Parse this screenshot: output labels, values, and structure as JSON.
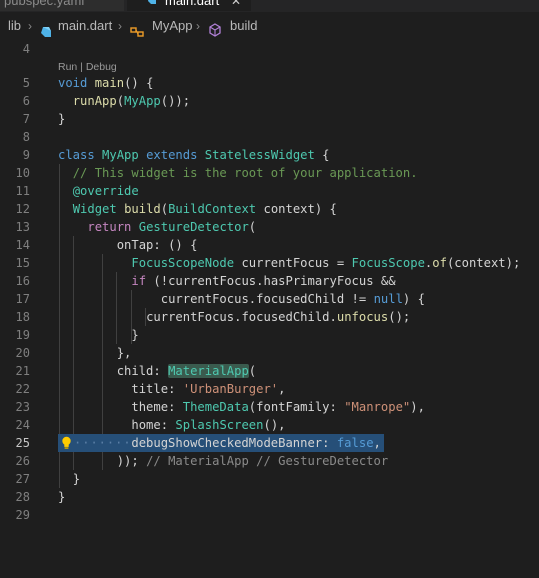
{
  "tabs": [
    {
      "label": "pubspec.yaml",
      "active": false
    },
    {
      "label": "main.dart",
      "active": true,
      "close_glyph": "✕"
    }
  ],
  "breadcrumb": {
    "items": [
      "lib",
      "main.dart",
      "MyApp",
      "build"
    ],
    "separator": "›",
    "icons": [
      "dart-file-icon",
      "class-icon",
      "method-cube-icon"
    ]
  },
  "codelens": "Run | Debug",
  "gutter": [
    "4",
    "5",
    "6",
    "7",
    "8",
    "9",
    "10",
    "11",
    "12",
    "13",
    "14",
    "15",
    "16",
    "17",
    "18",
    "19",
    "20",
    "21",
    "22",
    "23",
    "24",
    "25",
    "26",
    "27",
    "28",
    "29"
  ],
  "active_line_index": 21,
  "code": {
    "l5": {
      "t1": "void",
      "t2": " ",
      "t3": "main",
      "t4": "() {"
    },
    "l6": {
      "t1": "  ",
      "t2": "runApp",
      "t3": "(",
      "t4": "MyApp",
      "t5": "());"
    },
    "l7": {
      "t1": "}"
    },
    "l9": {
      "t1": "class",
      "t2": " ",
      "t3": "MyApp",
      "t4": " ",
      "t5": "extends",
      "t6": " ",
      "t7": "StatelessWidget",
      "t8": " {"
    },
    "l10": {
      "t1": "  ",
      "t2": "// This widget is the root of your application."
    },
    "l11": {
      "t1": "  ",
      "t2": "@override"
    },
    "l12": {
      "t1": "  ",
      "t2": "Widget",
      "t3": " ",
      "t4": "build",
      "t5": "(",
      "t6": "BuildContext",
      "t7": " ",
      "t8": "context",
      "t9": ") {"
    },
    "l13": {
      "t1": "    ",
      "t2": "return",
      "t3": " ",
      "t4": "GestureDetector",
      "t5": "("
    },
    "l14": {
      "t1": "        ",
      "t2": "onTap",
      "t3": ": () {"
    },
    "l15": {
      "t1": "          ",
      "t2": "FocusScopeNode",
      "t3": " ",
      "t4": "currentFocus",
      "t5": " = ",
      "t6": "FocusScope",
      "t7": ".",
      "t8": "of",
      "t9": "(",
      "t10": "context",
      "t11": ");"
    },
    "l16": {
      "t1": "          ",
      "t2": "if",
      "t3": " (!",
      "t4": "currentFocus",
      "t5": ".",
      "t6": "hasPrimaryFocus",
      "t7": " &&"
    },
    "l17": {
      "t1": "              ",
      "t2": "currentFocus",
      "t3": ".",
      "t4": "focusedChild",
      "t5": " != ",
      "t6": "null",
      "t7": ") {"
    },
    "l18": {
      "t1": "            ",
      "t2": "currentFocus",
      "t3": ".",
      "t4": "focusedChild",
      "t5": ".",
      "t6": "unfocus",
      "t7": "();"
    },
    "l19": {
      "t1": "          ",
      "t2": "}"
    },
    "l20": {
      "t1": "        ",
      "t2": "},"
    },
    "l21": {
      "t1": "        ",
      "t2": "child",
      "t3": ": ",
      "t4": "MaterialApp",
      "t5": "("
    },
    "l22": {
      "t1": "          ",
      "t2": "title",
      "t3": ": ",
      "t4": "'UrbanBurger'",
      "t5": ","
    },
    "l23": {
      "t1": "          ",
      "t2": "theme",
      "t3": ": ",
      "t4": "ThemeData",
      "t5": "(",
      "t6": "fontFamily",
      "t7": ": ",
      "t8": "\"Manrope\"",
      "t9": "),"
    },
    "l24": {
      "t1": "          ",
      "t2": "home",
      "t3": ": ",
      "t4": "SplashScreen",
      "t5": "(),"
    },
    "l25": {
      "t1": "          ",
      "t2": "debugShowCheckedModeBanner",
      "t3": ": ",
      "t4": "false",
      "t5": ","
    },
    "l26": {
      "t1": "        ",
      "t2": ")); ",
      "t3": "// MaterialApp // GestureDetector"
    },
    "l27": {
      "t1": "  ",
      "t2": "}"
    },
    "l28": {
      "t1": "}"
    }
  },
  "whitespace_dots": "········",
  "colors": {
    "background": "#1e1e1e",
    "keyword": "#569cd6",
    "control": "#c586c0",
    "function": "#dcdcaa",
    "class": "#4ec9b0",
    "string": "#ce9178",
    "comment": "#6a9955",
    "variable": "#9cdcfe",
    "selection": "#264f78"
  }
}
